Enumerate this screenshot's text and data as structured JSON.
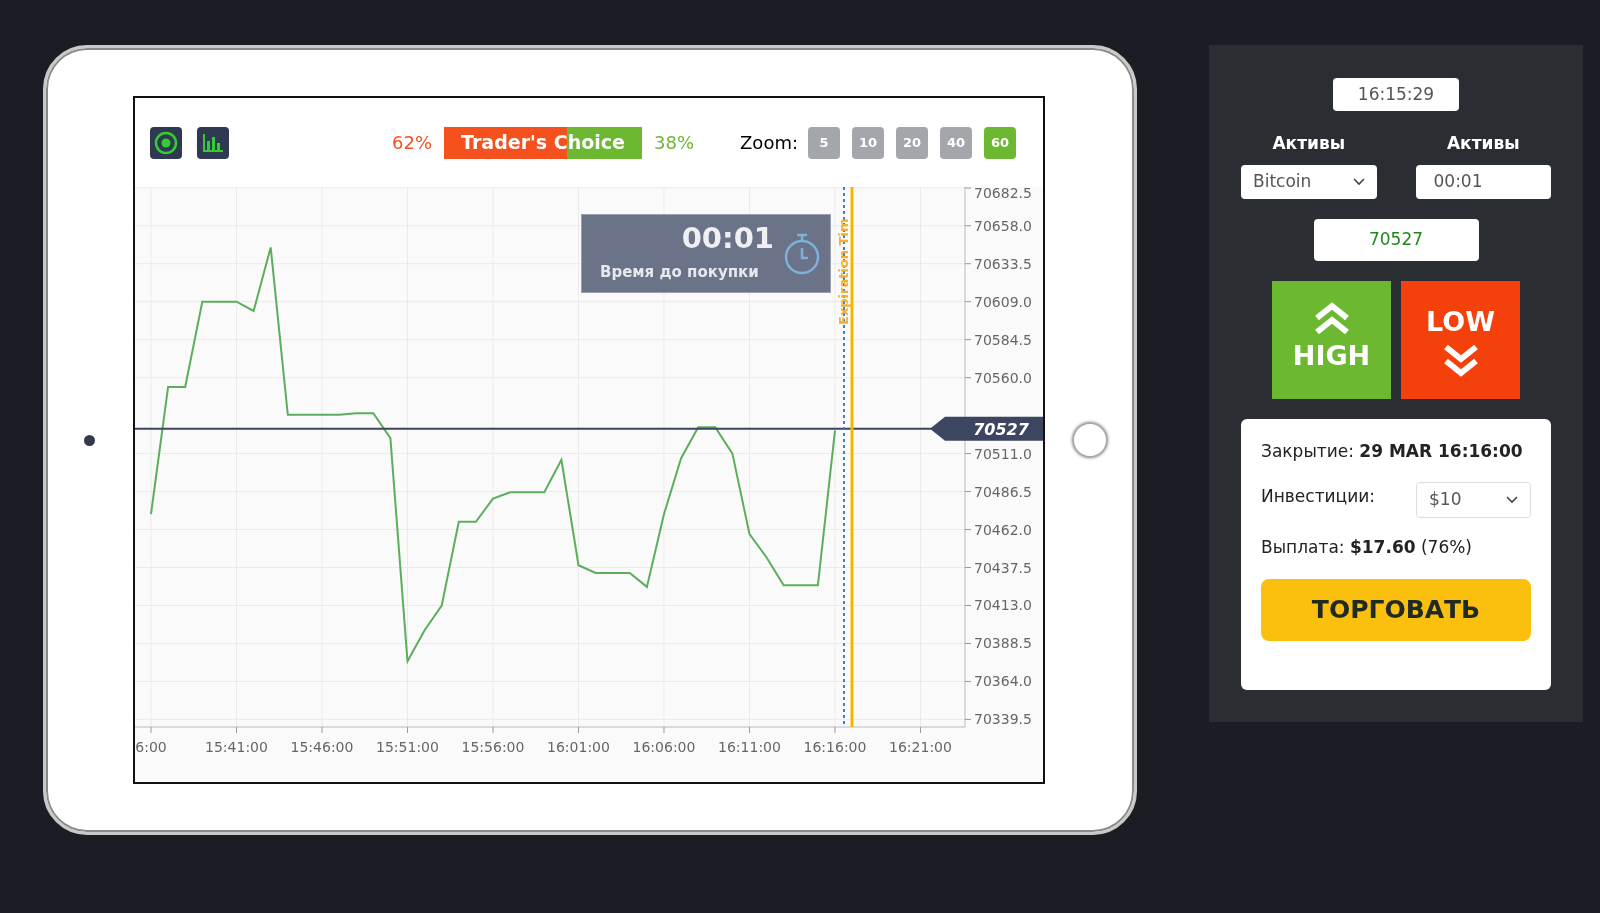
{
  "toolbar": {
    "sentiment": {
      "high_percent": "62%",
      "label": "Trader's Choice",
      "low_percent": "38%",
      "level": 0.62
    },
    "zoom": {
      "label": "Zoom:",
      "options": [
        {
          "label": "5",
          "selected": false
        },
        {
          "label": "10",
          "selected": false
        },
        {
          "label": "20",
          "selected": false
        },
        {
          "label": "40",
          "selected": false
        },
        {
          "label": "60",
          "selected": true
        }
      ]
    }
  },
  "chart": {
    "timer": {
      "time": "00:01",
      "caption": "Время до покупки"
    },
    "current_price": "70527",
    "expiration_label": "Expiration Tim",
    "chart_data": {
      "type": "line",
      "categories": [
        "6:00",
        null,
        null,
        null,
        null,
        "15:41:00",
        null,
        null,
        null,
        null,
        "15:46:00",
        null,
        null,
        null,
        null,
        "15:51:00",
        null,
        null,
        null,
        null,
        "15:56:00",
        null,
        null,
        null,
        null,
        "16:01:00",
        null,
        null,
        null,
        null,
        "16:06:00",
        null,
        null,
        null,
        null,
        "16:11:00",
        null,
        null,
        null,
        null,
        "16:16:00",
        null,
        null,
        null,
        null,
        "16:21:00",
        null,
        null
      ],
      "series": [
        {
          "color": "#5cae5c",
          "values": [
            70472,
            70554,
            70554,
            70609,
            70609,
            70609,
            70603,
            70644,
            70536,
            70536,
            70536,
            70536,
            70537,
            70537,
            70521,
            70377,
            70397,
            70413,
            70467,
            70467,
            70482,
            70486,
            70486,
            70486,
            70507,
            70439,
            70434,
            70434,
            70434,
            70425,
            70472,
            70508,
            70528,
            70528,
            70511,
            70459,
            70444,
            70426,
            70426,
            70426,
            70526,
            null,
            null,
            null,
            null,
            null,
            null,
            null
          ]
        }
      ],
      "ylim": [
        70334.6,
        70683
      ],
      "grid": true,
      "ref_lines": [
        {
          "axis": "y",
          "value": 70527,
          "color": "#3c4660"
        }
      ],
      "yticks": [
        {
          "value": 70682.5,
          "label": "70682.5"
        },
        {
          "value": 70658,
          "label": "70658.0"
        },
        {
          "value": 70633.5,
          "label": "70633.5"
        },
        {
          "value": 70609,
          "label": "70609.0"
        },
        {
          "value": 70584.5,
          "label": "70584.5"
        },
        {
          "value": 70560,
          "label": "70560.0"
        },
        {
          "value": 70511,
          "label": "70511.0"
        },
        {
          "value": 70486.5,
          "label": "70486.5"
        },
        {
          "value": 70462,
          "label": "70462.0"
        },
        {
          "value": 70437.5,
          "label": "70437.5"
        },
        {
          "value": 70413,
          "label": "70413.0"
        },
        {
          "value": 70388.5,
          "label": "70388.5"
        },
        {
          "value": 70364,
          "label": "70364.0"
        },
        {
          "value": 70339.5,
          "label": "70339.5"
        }
      ]
    }
  },
  "panel": {
    "clock": "16:15:29",
    "asset_label": "Активы",
    "asset": "Bitcoin",
    "time_label": "Активы",
    "time_value": "00:01",
    "price": "70527",
    "high": "HIGH",
    "low": "LOW",
    "closing_label": "Закрытие:",
    "closing_value": "29 MAR 16:16:00",
    "investment_label": "Инвестиции:",
    "investment": "$10",
    "payout_label": "Выплата:",
    "payout_value": "$17.60",
    "payout_percent": "(76%)",
    "trade_button": "ТОРГОВАТЬ"
  }
}
